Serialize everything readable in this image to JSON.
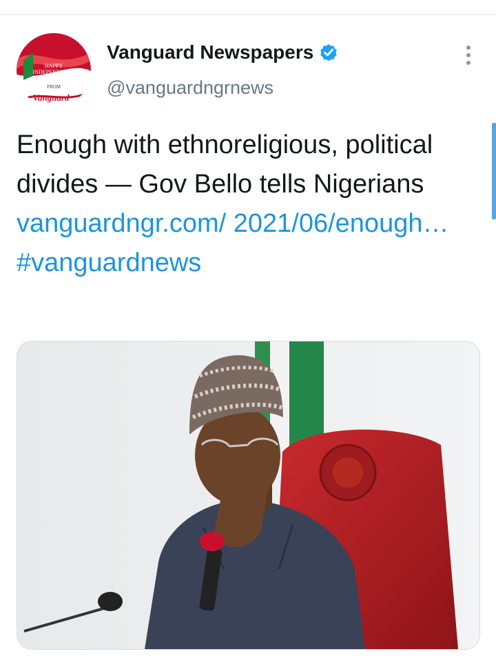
{
  "avatar": {
    "lines": [
      "HAPPY",
      "INDEPENDENCE",
      "DAY",
      "FROM",
      "Vanguard"
    ]
  },
  "author": {
    "name": "Vanguard Newspapers",
    "handle": "@vanguardngrnews",
    "verified": true
  },
  "tweet": {
    "text_plain": "Enough with ethnoreligious, political divides — Gov Bello tells Nigerians",
    "link": "vanguardngr.com/ 2021/06/enough…",
    "hashtag": "#vanguardnews"
  },
  "colors": {
    "link": "#1b95e0",
    "verified": "#1da1f2",
    "chair": "#b51f24",
    "agbada": "#3a4258"
  },
  "icons": {
    "verified": "verified-badge-icon",
    "more": "more-options-icon"
  }
}
